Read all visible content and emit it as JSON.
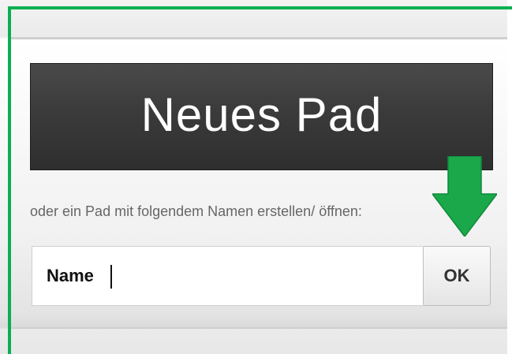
{
  "new_pad": {
    "label": "Neues Pad"
  },
  "open_form": {
    "prompt_text": "oder ein Pad mit folgendem Namen erstellen/ öffnen:",
    "name_input": {
      "value": "Name"
    },
    "ok_label": "OK"
  },
  "annotation": {
    "arrow_icon": "down-arrow-icon",
    "color": "#1aa84a",
    "border_color": "#08b050"
  }
}
